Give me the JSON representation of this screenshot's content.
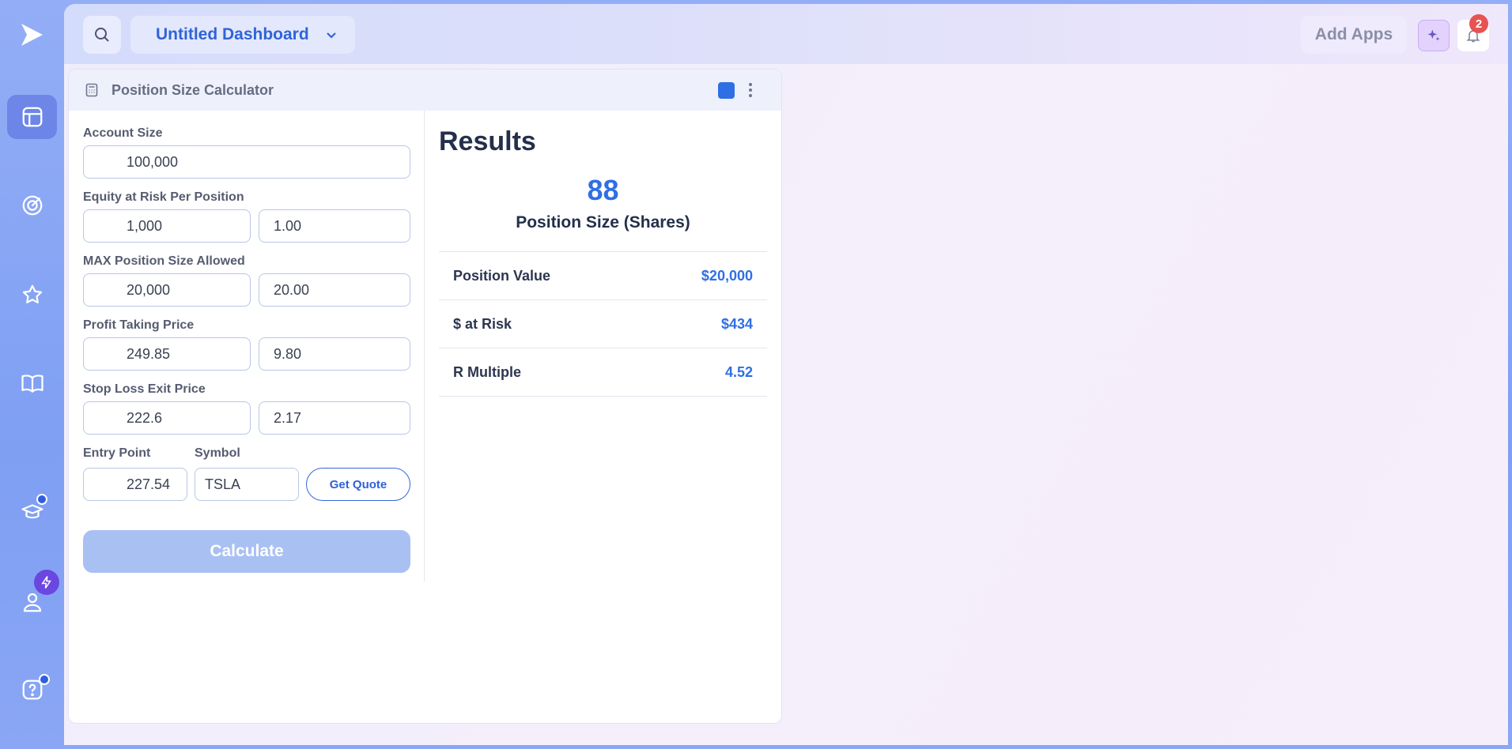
{
  "header": {
    "dashboard_name": "Untitled Dashboard",
    "add_apps_label": "Add Apps",
    "notification_count": "2"
  },
  "widget": {
    "title": "Position Size Calculator",
    "accent_color": "#2f6fe4"
  },
  "form": {
    "account_size": {
      "label": "Account Size",
      "value": "100,000"
    },
    "equity_risk": {
      "label": "Equity at Risk Per Position",
      "value": "1,000",
      "percent": "1.00"
    },
    "max_position": {
      "label": "MAX Position Size Allowed",
      "value": "20,000",
      "percent": "20.00"
    },
    "profit_taking": {
      "label": "Profit Taking Price",
      "value": "249.85",
      "percent": "9.80"
    },
    "stop_loss": {
      "label": "Stop Loss Exit Price",
      "value": "222.6",
      "percent": "2.17"
    },
    "entry_point": {
      "label": "Entry Point",
      "value": "227.54"
    },
    "symbol": {
      "label": "Symbol",
      "value": "TSLA"
    },
    "get_quote_label": "Get Quote",
    "calculate_label": "Calculate"
  },
  "results": {
    "title": "Results",
    "position_size": "88",
    "position_size_label": "Position Size (Shares)",
    "rows": [
      {
        "label": "Position Value",
        "value": "$20,000"
      },
      {
        "label": "$ at Risk",
        "value": "$434"
      },
      {
        "label": "R Multiple",
        "value": "4.52"
      }
    ]
  },
  "icons": {
    "sidebar": [
      "dashboard-icon",
      "target-icon",
      "star-icon",
      "book-icon",
      "graduation-cap-icon",
      "user-icon",
      "help-icon"
    ],
    "topbar": [
      "search-icon",
      "chevron-down-icon",
      "sparkle-icon",
      "bell-icon"
    ]
  }
}
